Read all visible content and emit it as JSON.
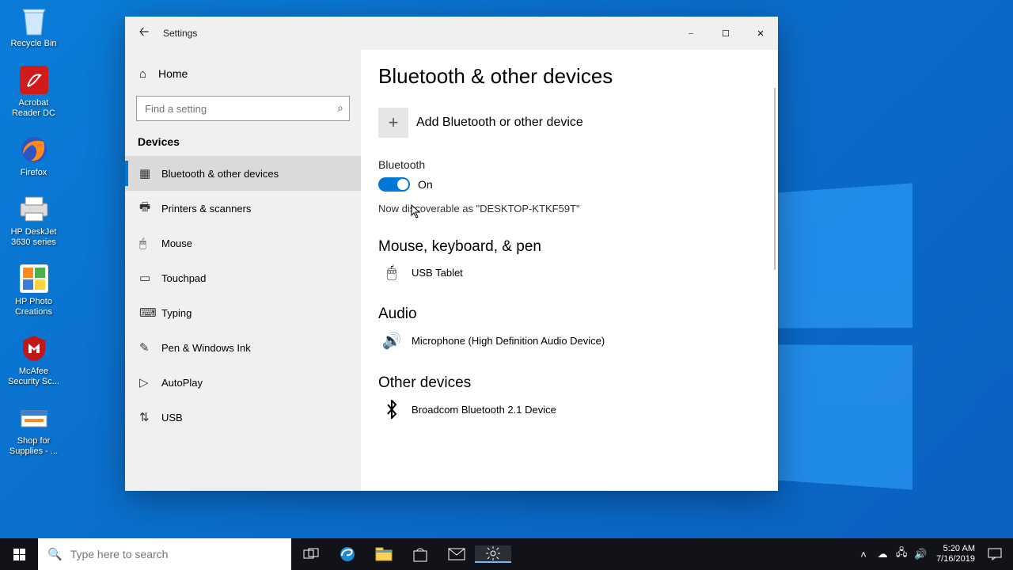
{
  "desktop": {
    "icons": [
      {
        "name": "recycle-bin",
        "label": "Recycle Bin"
      },
      {
        "name": "acrobat",
        "label": "Acrobat Reader DC"
      },
      {
        "name": "firefox",
        "label": "Firefox"
      },
      {
        "name": "hp-deskjet",
        "label": "HP DeskJet 3630 series"
      },
      {
        "name": "hp-photo",
        "label": "HP Photo Creations"
      },
      {
        "name": "mcafee",
        "label": "McAfee Security Sc..."
      },
      {
        "name": "shop-supplies",
        "label": "Shop for Supplies - ..."
      }
    ]
  },
  "settings_window": {
    "title": "Settings",
    "home_label": "Home",
    "search_placeholder": "Find a setting",
    "section": "Devices",
    "nav": [
      {
        "id": "bluetooth",
        "label": "Bluetooth & other devices",
        "active": true
      },
      {
        "id": "printers",
        "label": "Printers & scanners"
      },
      {
        "id": "mouse",
        "label": "Mouse"
      },
      {
        "id": "touchpad",
        "label": "Touchpad"
      },
      {
        "id": "typing",
        "label": "Typing"
      },
      {
        "id": "pen",
        "label": "Pen & Windows Ink"
      },
      {
        "id": "autoplay",
        "label": "AutoPlay"
      },
      {
        "id": "usb",
        "label": "USB"
      }
    ],
    "content": {
      "page_title": "Bluetooth & other devices",
      "add_device_label": "Add Bluetooth or other device",
      "bluetooth_heading": "Bluetooth",
      "toggle_state": "On",
      "discoverable_text": "Now discoverable as \"DESKTOP-KTKF59T\"",
      "section_mouse": "Mouse, keyboard, & pen",
      "device_mouse": "USB Tablet",
      "section_audio": "Audio",
      "device_audio": "Microphone (High Definition Audio Device)",
      "section_other": "Other devices",
      "device_other": "Broadcom Bluetooth 2.1 Device"
    }
  },
  "taskbar": {
    "search_placeholder": "Type here to search",
    "time": "5:20 AM",
    "date": "7/16/2019"
  }
}
